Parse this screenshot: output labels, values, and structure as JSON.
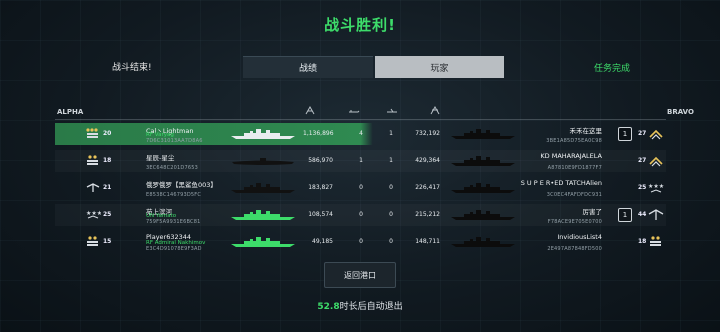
{
  "title": "战斗胜利!",
  "tabs": {
    "battle_over": "战斗结束!",
    "stats": "战绩",
    "player": "玩家",
    "mission_done": "任务完成"
  },
  "teams": {
    "alpha": "ALPHA",
    "bravo": "BRAVO"
  },
  "columns": [
    "damage-icon",
    "torpedo-icon",
    "plane-icon",
    "kill-icon"
  ],
  "colors": {
    "accent_green": "#3ddc6a",
    "ship_green": "#3ddc6a",
    "highlight": "#2f8a51"
  },
  "alpha_rows": [
    {
      "level": "20",
      "name": "Cal丶Lightman",
      "ship": "RF Varyag",
      "id": "7D6C31013AA7D8A6",
      "damage": "1,136,896",
      "kills": "4",
      "ship_color": "#e8ecef"
    },
    {
      "level": "18",
      "name": "星辰-星尘",
      "ship": "",
      "id": "3EC648C201D7653",
      "damage": "586,970",
      "kills": "1",
      "ship_color": "#111111"
    },
    {
      "level": "21",
      "name": "俄罗俄罗【黑鲨鱼003】",
      "ship": "",
      "id": "E8538C146793D5FC",
      "damage": "183,827",
      "kills": "0",
      "ship_color": "#111111"
    },
    {
      "level": "25",
      "name": "苑上滨河",
      "ship": "UN Yamato",
      "id": "759F5A9931E6BC81",
      "damage": "108,574",
      "kills": "0",
      "ship_color": "#3ddc6a"
    },
    {
      "level": "15",
      "name": "Player632344",
      "ship": "RF Admiral Nakhimov",
      "id": "E3C4D91078E9F3AD",
      "damage": "49,185",
      "kills": "0",
      "ship_color": "#3ddc6a"
    }
  ],
  "bravo_rows": [
    {
      "level": "27",
      "name": "禾禾在这里",
      "id": "3BE1A85D75EA0C98",
      "damage": "732,192",
      "kills": "1",
      "badge": "1"
    },
    {
      "level": "27",
      "name": "KD MAHARAJALELA",
      "id": "A87810E9FD1877F7",
      "damage": "429,364",
      "kills": "1",
      "badge": ""
    },
    {
      "level": "25",
      "name": "S U P E R•ED TATCHAlien",
      "id": "3C0EC4FAFDFDC931",
      "damage": "226,417",
      "kills": "0",
      "badge": ""
    },
    {
      "level": "44",
      "name": "厉害了",
      "id": "F78ACE9E705E0700",
      "damage": "215,212",
      "kills": "0",
      "badge": "1"
    },
    {
      "level": "18",
      "name": "InvidiousList4",
      "id": "2E497A87848FD500",
      "damage": "148,711",
      "kills": "0",
      "badge": ""
    }
  ],
  "return_button": "返回港口",
  "countdown": {
    "seconds": "52.8",
    "text": "时长后自动退出"
  }
}
